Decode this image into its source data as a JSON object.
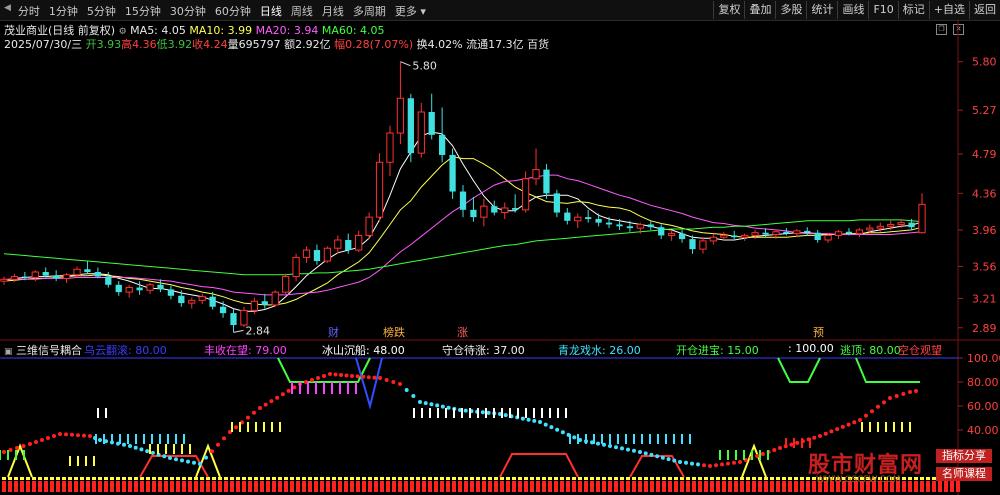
{
  "toolbar": {
    "periods": [
      "分时",
      "1分钟",
      "5分钟",
      "15分钟",
      "30分钟",
      "60分钟",
      "日线",
      "周线",
      "月线",
      "多周期",
      "更多"
    ],
    "active_period": "日线",
    "right_buttons": [
      "复权",
      "叠加",
      "多股",
      "统计",
      "画线",
      "F10",
      "标记",
      "+自选",
      "返回"
    ]
  },
  "header": {
    "title": "茂业商业(日线 前复权)",
    "ma5": "MA5: 4.05",
    "ma10": "MA10: 3.99",
    "ma20": "MA20: 3.94",
    "ma60": "MA60: 4.05",
    "date": "2025/07/30/三",
    "open": "开3.93",
    "high": "高4.36",
    "low": "低3.92",
    "close": "收4.24",
    "volume": "量695797",
    "amount": "额2.92亿",
    "change": "幅0.28(7.07%)",
    "turnover": "换4.02%",
    "float_cap": "流通17.3亿",
    "sector": "百货"
  },
  "indicator": {
    "name": "三维信号耦合",
    "fields": [
      {
        "label": "乌云翻滚: 80.00",
        "color": "#3b3bff"
      },
      {
        "label": "丰收在望: 79.00",
        "color": "#ff40ff"
      },
      {
        "label": "冰山沉船: 48.00",
        "color": "#ffffff"
      },
      {
        "label": "守仓待涨: 37.00",
        "color": "#f0f0f0"
      },
      {
        "label": "青龙戏水: 26.00",
        "color": "#40e0ff"
      },
      {
        "label": "开仓进宝: 15.00",
        "color": "#40ff40"
      },
      {
        "label": ": 100.00",
        "color": "#ffffff"
      },
      {
        "label": "逃顶: 80.00",
        "color": "#40ff40"
      },
      {
        "label": "空仓观望",
        "color": "#ff4040"
      }
    ],
    "axis_ticks": [
      "100.00",
      "80.00",
      "60.00",
      "40.00"
    ]
  },
  "signals": [
    {
      "text": "财",
      "color": "#6060ff"
    },
    {
      "text": "榜跌",
      "color": "#ffb040"
    },
    {
      "text": "涨",
      "color": "#ff6060"
    },
    {
      "text": "预",
      "color": "#ffb040"
    }
  ],
  "watermark": {
    "brand": "股市财富网",
    "url": "WWW.GSCFW.COM",
    "tag1": "指标分享",
    "tag2": "名师课程"
  },
  "chart_data": {
    "type": "candlestick",
    "y_ticks": [
      5.8,
      5.27,
      4.79,
      4.36,
      3.96,
      3.56,
      3.21,
      2.89
    ],
    "ylim": [
      2.8,
      5.95
    ],
    "high_label": "5.80",
    "low_label": "2.84",
    "candles": [
      [
        3.4,
        3.45,
        3.36,
        3.42
      ],
      [
        3.42,
        3.48,
        3.39,
        3.45
      ],
      [
        3.45,
        3.5,
        3.41,
        3.44
      ],
      [
        3.44,
        3.52,
        3.4,
        3.5
      ],
      [
        3.5,
        3.55,
        3.44,
        3.46
      ],
      [
        3.46,
        3.52,
        3.4,
        3.43
      ],
      [
        3.43,
        3.49,
        3.38,
        3.47
      ],
      [
        3.47,
        3.56,
        3.44,
        3.53
      ],
      [
        3.53,
        3.62,
        3.48,
        3.5
      ],
      [
        3.5,
        3.55,
        3.43,
        3.45
      ],
      [
        3.45,
        3.5,
        3.33,
        3.36
      ],
      [
        3.36,
        3.4,
        3.24,
        3.28
      ],
      [
        3.28,
        3.36,
        3.22,
        3.33
      ],
      [
        3.33,
        3.4,
        3.25,
        3.3
      ],
      [
        3.3,
        3.38,
        3.26,
        3.36
      ],
      [
        3.36,
        3.42,
        3.28,
        3.31
      ],
      [
        3.31,
        3.35,
        3.2,
        3.24
      ],
      [
        3.24,
        3.3,
        3.12,
        3.16
      ],
      [
        3.16,
        3.22,
        3.1,
        3.19
      ],
      [
        3.19,
        3.26,
        3.15,
        3.23
      ],
      [
        3.23,
        3.28,
        3.09,
        3.12
      ],
      [
        3.12,
        3.18,
        3.0,
        3.05
      ],
      [
        3.05,
        3.1,
        2.84,
        2.92
      ],
      [
        2.92,
        3.12,
        2.9,
        3.08
      ],
      [
        3.08,
        3.22,
        3.04,
        3.18
      ],
      [
        3.18,
        3.26,
        3.1,
        3.14
      ],
      [
        3.14,
        3.3,
        3.12,
        3.28
      ],
      [
        3.28,
        3.48,
        3.26,
        3.45
      ],
      [
        3.45,
        3.7,
        3.4,
        3.66
      ],
      [
        3.66,
        3.78,
        3.6,
        3.74
      ],
      [
        3.74,
        3.8,
        3.58,
        3.62
      ],
      [
        3.62,
        3.78,
        3.6,
        3.76
      ],
      [
        3.76,
        3.9,
        3.7,
        3.85
      ],
      [
        3.85,
        3.92,
        3.7,
        3.74
      ],
      [
        3.74,
        3.95,
        3.72,
        3.9
      ],
      [
        3.9,
        4.15,
        3.86,
        4.1
      ],
      [
        4.1,
        4.8,
        4.05,
        4.7
      ],
      [
        4.7,
        5.1,
        4.55,
        5.02
      ],
      [
        5.02,
        5.8,
        4.9,
        5.4
      ],
      [
        5.4,
        5.45,
        4.7,
        4.8
      ],
      [
        4.8,
        5.35,
        4.75,
        5.25
      ],
      [
        5.25,
        5.45,
        4.95,
        5.0
      ],
      [
        5.0,
        5.3,
        4.7,
        4.78
      ],
      [
        4.78,
        4.85,
        4.3,
        4.38
      ],
      [
        4.38,
        4.45,
        4.1,
        4.18
      ],
      [
        4.18,
        4.32,
        4.05,
        4.1
      ],
      [
        4.1,
        4.3,
        4.0,
        4.22
      ],
      [
        4.22,
        4.28,
        4.12,
        4.15
      ],
      [
        4.15,
        4.26,
        4.08,
        4.2
      ],
      [
        4.2,
        4.35,
        4.15,
        4.18
      ],
      [
        4.18,
        4.6,
        4.15,
        4.52
      ],
      [
        4.52,
        4.85,
        4.45,
        4.62
      ],
      [
        4.62,
        4.68,
        4.3,
        4.36
      ],
      [
        4.36,
        4.4,
        4.1,
        4.15
      ],
      [
        4.15,
        4.2,
        4.02,
        4.06
      ],
      [
        4.06,
        4.14,
        3.98,
        4.1
      ],
      [
        4.1,
        4.18,
        4.04,
        4.08
      ],
      [
        4.08,
        4.14,
        4.0,
        4.04
      ],
      [
        4.04,
        4.1,
        3.98,
        4.02
      ],
      [
        4.02,
        4.08,
        3.96,
        4.0
      ],
      [
        4.0,
        4.06,
        3.94,
        3.98
      ],
      [
        3.98,
        4.04,
        3.92,
        4.02
      ],
      [
        4.02,
        4.06,
        3.96,
        3.99
      ],
      [
        3.99,
        4.02,
        3.86,
        3.9
      ],
      [
        3.9,
        3.96,
        3.84,
        3.92
      ],
      [
        3.92,
        3.96,
        3.82,
        3.86
      ],
      [
        3.86,
        3.9,
        3.7,
        3.75
      ],
      [
        3.75,
        3.88,
        3.7,
        3.84
      ],
      [
        3.84,
        3.92,
        3.8,
        3.88
      ],
      [
        3.88,
        3.94,
        3.84,
        3.9
      ],
      [
        3.9,
        3.95,
        3.86,
        3.88
      ],
      [
        3.88,
        3.92,
        3.84,
        3.9
      ],
      [
        3.9,
        3.96,
        3.86,
        3.93
      ],
      [
        3.93,
        3.98,
        3.88,
        3.91
      ],
      [
        3.91,
        3.96,
        3.86,
        3.94
      ],
      [
        3.94,
        3.98,
        3.9,
        3.92
      ],
      [
        3.92,
        3.97,
        3.88,
        3.95
      ],
      [
        3.95,
        3.99,
        3.9,
        3.93
      ],
      [
        3.93,
        3.96,
        3.82,
        3.85
      ],
      [
        3.85,
        3.92,
        3.82,
        3.9
      ],
      [
        3.9,
        3.96,
        3.86,
        3.94
      ],
      [
        3.94,
        3.98,
        3.9,
        3.92
      ],
      [
        3.92,
        3.98,
        3.88,
        3.96
      ],
      [
        3.96,
        4.02,
        3.92,
        3.98
      ],
      [
        3.98,
        4.04,
        3.94,
        4.0
      ],
      [
        4.0,
        4.06,
        3.96,
        4.02
      ],
      [
        4.02,
        4.08,
        3.98,
        4.04
      ],
      [
        4.04,
        4.08,
        3.96,
        3.99
      ],
      [
        3.93,
        4.36,
        3.92,
        4.24
      ]
    ],
    "ma_series": [
      {
        "name": "MA5",
        "color": "#ffffff",
        "values": [
          3.41,
          3.43,
          3.44,
          3.45,
          3.45,
          3.46,
          3.46,
          3.47,
          3.48,
          3.48,
          3.47,
          3.43,
          3.4,
          3.36,
          3.32,
          3.32,
          3.3,
          3.27,
          3.25,
          3.23,
          3.19,
          3.15,
          3.1,
          3.07,
          3.07,
          3.09,
          3.13,
          3.23,
          3.34,
          3.46,
          3.55,
          3.64,
          3.71,
          3.74,
          3.77,
          3.87,
          4.07,
          4.34,
          4.63,
          4.81,
          4.99,
          5.03,
          5.01,
          4.88,
          4.68,
          4.5,
          4.33,
          4.21,
          4.17,
          4.17,
          4.25,
          4.32,
          4.34,
          4.34,
          4.34,
          4.3,
          4.2,
          4.12,
          4.08,
          4.06,
          4.04,
          4.02,
          4.0,
          3.97,
          3.96,
          3.92,
          3.88,
          3.87,
          3.87,
          3.85,
          3.85,
          3.87,
          3.89,
          3.9,
          3.91,
          3.92,
          3.93,
          3.93,
          3.92,
          3.91,
          3.91,
          3.91,
          3.91,
          3.94,
          3.96,
          3.98,
          4.0,
          4.01,
          4.05
        ]
      },
      {
        "name": "MA10",
        "color": "#ffff54",
        "values": [
          3.4,
          3.41,
          3.42,
          3.43,
          3.43,
          3.44,
          3.45,
          3.46,
          3.46,
          3.47,
          3.46,
          3.45,
          3.43,
          3.42,
          3.4,
          3.38,
          3.36,
          3.33,
          3.31,
          3.28,
          3.26,
          3.23,
          3.19,
          3.16,
          3.15,
          3.14,
          3.14,
          3.16,
          3.2,
          3.26,
          3.32,
          3.38,
          3.47,
          3.54,
          3.61,
          3.71,
          3.86,
          4.02,
          4.18,
          4.28,
          4.43,
          4.55,
          4.67,
          4.76,
          4.74,
          4.74,
          4.68,
          4.61,
          4.52,
          4.43,
          4.37,
          4.32,
          4.27,
          4.26,
          4.25,
          4.27,
          4.26,
          4.23,
          4.21,
          4.2,
          4.17,
          4.11,
          4.06,
          4.03,
          4.01,
          3.98,
          3.95,
          3.93,
          3.92,
          3.91,
          3.89,
          3.88,
          3.88,
          3.88,
          3.88,
          3.88,
          3.89,
          3.9,
          3.9,
          3.91,
          3.91,
          3.92,
          3.92,
          3.93,
          3.93,
          3.94,
          3.95,
          3.96,
          3.99
        ]
      },
      {
        "name": "MA20",
        "color": "#ff5cff",
        "values": [
          3.42,
          3.42,
          3.42,
          3.42,
          3.43,
          3.43,
          3.43,
          3.44,
          3.44,
          3.44,
          3.44,
          3.44,
          3.44,
          3.43,
          3.42,
          3.41,
          3.4,
          3.38,
          3.36,
          3.34,
          3.33,
          3.31,
          3.28,
          3.27,
          3.26,
          3.25,
          3.25,
          3.25,
          3.26,
          3.27,
          3.28,
          3.3,
          3.33,
          3.36,
          3.39,
          3.44,
          3.52,
          3.62,
          3.72,
          3.8,
          3.89,
          3.98,
          4.07,
          4.16,
          4.23,
          4.31,
          4.38,
          4.45,
          4.49,
          4.5,
          4.52,
          4.54,
          4.56,
          4.56,
          4.52,
          4.5,
          4.46,
          4.42,
          4.38,
          4.34,
          4.31,
          4.27,
          4.23,
          4.2,
          4.17,
          4.14,
          4.1,
          4.07,
          4.04,
          4.03,
          4.01,
          4.0,
          3.98,
          3.97,
          3.96,
          3.95,
          3.93,
          3.92,
          3.92,
          3.92,
          3.91,
          3.91,
          3.91,
          3.91,
          3.91,
          3.91,
          3.92,
          3.93,
          3.94
        ]
      },
      {
        "name": "MA60",
        "color": "#40ff40",
        "values": [
          3.7,
          3.69,
          3.68,
          3.67,
          3.66,
          3.65,
          3.64,
          3.63,
          3.62,
          3.61,
          3.6,
          3.59,
          3.58,
          3.57,
          3.56,
          3.55,
          3.54,
          3.53,
          3.52,
          3.51,
          3.5,
          3.49,
          3.48,
          3.47,
          3.47,
          3.47,
          3.47,
          3.47,
          3.48,
          3.48,
          3.49,
          3.49,
          3.5,
          3.51,
          3.52,
          3.53,
          3.55,
          3.57,
          3.59,
          3.61,
          3.63,
          3.65,
          3.67,
          3.69,
          3.71,
          3.73,
          3.75,
          3.77,
          3.79,
          3.8,
          3.82,
          3.84,
          3.85,
          3.86,
          3.87,
          3.88,
          3.89,
          3.9,
          3.91,
          3.92,
          3.93,
          3.94,
          3.95,
          3.96,
          3.97,
          3.97,
          3.97,
          3.98,
          3.99,
          3.99,
          4.0,
          4.0,
          4.01,
          4.02,
          4.03,
          4.04,
          4.05,
          4.06,
          4.06,
          4.06,
          4.06,
          4.06,
          4.07,
          4.07,
          4.07,
          4.07,
          4.07,
          4.06,
          4.05
        ]
      }
    ]
  }
}
